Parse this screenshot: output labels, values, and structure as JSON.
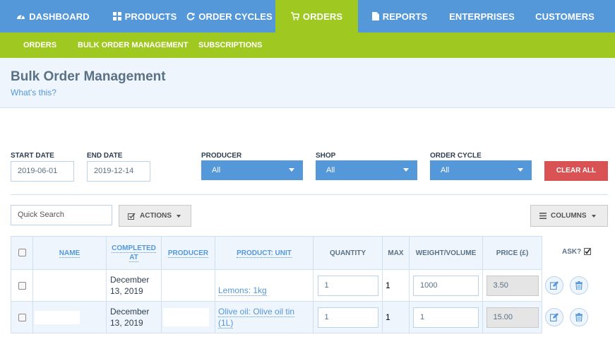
{
  "topnav": {
    "items": [
      {
        "label": "DASHBOARD",
        "icon": "dashboard-icon"
      },
      {
        "label": "PRODUCTS",
        "icon": "grid-icon"
      },
      {
        "label": "ORDER CYCLES",
        "icon": "refresh-icon"
      },
      {
        "label": "ORDERS",
        "icon": "cart-icon",
        "active": true
      },
      {
        "label": "REPORTS",
        "icon": "file-icon"
      },
      {
        "label": "ENTERPRISES"
      },
      {
        "label": "CUSTOMERS"
      }
    ]
  },
  "subnav": {
    "items": [
      {
        "label": "ORDERS"
      },
      {
        "label": "BULK ORDER MANAGEMENT",
        "active": true
      },
      {
        "label": "SUBSCRIPTIONS"
      }
    ]
  },
  "header": {
    "title": "Bulk Order Management",
    "help_link": "What's this?"
  },
  "filters": {
    "start_date_label": "START DATE",
    "start_date_value": "2019-06-01",
    "end_date_label": "END DATE",
    "end_date_value": "2019-12-14",
    "producer_label": "PRODUCER",
    "producer_value": "All",
    "shop_label": "SHOP",
    "shop_value": "All",
    "order_cycle_label": "ORDER CYCLE",
    "order_cycle_value": "All",
    "clear_all": "CLEAR ALL"
  },
  "toolbar": {
    "search_placeholder": "Quick Search",
    "actions_label": "ACTIONS",
    "columns_label": "COLUMNS"
  },
  "table": {
    "headers": {
      "name": "NAME",
      "completed_at_1": "COMPLETED",
      "completed_at_2": "AT",
      "producer": "PRODUCER",
      "product_unit": "PRODUCT: UNIT",
      "quantity": "QUANTITY",
      "max": "MAX",
      "weight_volume": "WEIGHT/VOLUME",
      "price": "PRICE (£)",
      "ask": "ASK?"
    },
    "rows": [
      {
        "name": "",
        "completed_at_1": "December",
        "completed_at_2": "13, 2019",
        "producer": "",
        "product_1": "Lemons: 1kg",
        "product_2": "",
        "quantity": "1",
        "max": "1",
        "weight_volume": "1000",
        "price": "3.50"
      },
      {
        "name": "",
        "completed_at_1": "December",
        "completed_at_2": "13, 2019",
        "producer": "",
        "product_1": "Olive oil: Olive oil tin",
        "product_2": "(1L)",
        "quantity": "1",
        "max": "1",
        "weight_volume": "1",
        "price": "15.00"
      }
    ]
  },
  "colors": {
    "primary_blue": "#5498da",
    "accent_green": "#9fc820",
    "danger_red": "#da5354",
    "light_bg": "#eff5fc"
  }
}
